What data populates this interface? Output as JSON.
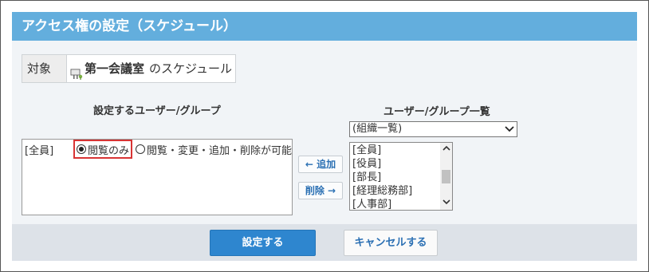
{
  "header": {
    "title": "アクセス権の設定（スケジュール）"
  },
  "target": {
    "label": "対象",
    "icon": "meeting-room-icon",
    "name": "第一会議室",
    "suffix": "のスケジュール"
  },
  "left_panel": {
    "title": "設定するユーザー/グループ",
    "rows": [
      {
        "name": "[全員]",
        "options": [
          {
            "label": "閲覧のみ",
            "checked": true
          },
          {
            "label": "閲覧・変更・追加・削除が可能",
            "checked": false
          }
        ]
      }
    ]
  },
  "move_buttons": {
    "add": "← 追加",
    "remove": "削除 →"
  },
  "right_panel": {
    "title": "ユーザー/グループ一覧",
    "select_value": "(組織一覧)",
    "list_items": [
      "[全員]",
      "[役員]",
      "[部長]",
      "[経理総務部]",
      "[人事部]"
    ]
  },
  "footer": {
    "submit": "設定する",
    "cancel": "キャンセルする"
  },
  "colors": {
    "header_bg": "#63aedd",
    "primary_button": "#2e86cf",
    "highlight_border": "#d83434"
  }
}
